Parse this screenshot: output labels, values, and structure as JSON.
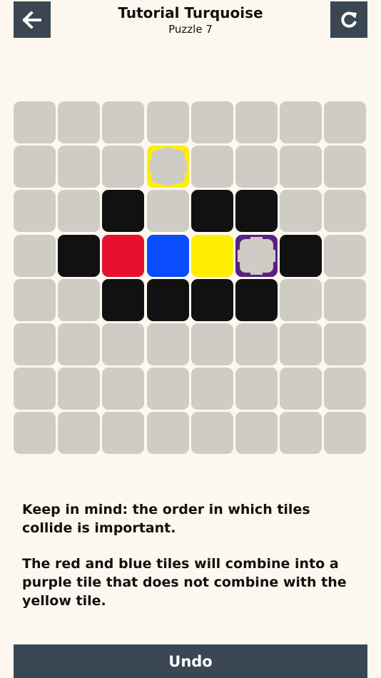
{
  "header": {
    "title": "Tutorial Turquoise",
    "subtitle": "Puzzle 7",
    "back_icon": "arrow-left-icon",
    "restart_icon": "restart-icon"
  },
  "colors": {
    "background": "#fdf8ef",
    "button": "#3a4753",
    "empty_cell": "#cfcbc5",
    "black": "#111111",
    "red": "#e8112d",
    "blue": "#0a4dff",
    "yellow": "#ffee00",
    "purple": "#5a1f82"
  },
  "board": {
    "rows": 8,
    "cols": 8,
    "grid": [
      [
        "empty",
        "empty",
        "empty",
        "empty",
        "empty",
        "empty",
        "empty",
        "empty"
      ],
      [
        "empty",
        "empty",
        "empty",
        "target-yellow",
        "empty",
        "empty",
        "empty",
        "empty"
      ],
      [
        "empty",
        "empty",
        "black",
        "empty",
        "black",
        "black",
        "empty",
        "empty"
      ],
      [
        "empty",
        "black",
        "red",
        "blue",
        "yellow",
        "target-purple",
        "black",
        "empty"
      ],
      [
        "empty",
        "empty",
        "black",
        "black",
        "black",
        "black",
        "empty",
        "empty"
      ],
      [
        "empty",
        "empty",
        "empty",
        "empty",
        "empty",
        "empty",
        "empty",
        "empty"
      ],
      [
        "empty",
        "empty",
        "empty",
        "empty",
        "empty",
        "empty",
        "empty",
        "empty"
      ],
      [
        "empty",
        "empty",
        "empty",
        "empty",
        "empty",
        "empty",
        "empty",
        "empty"
      ]
    ]
  },
  "hint": {
    "paragraph1": "Keep in mind: the order in which tiles collide is important.",
    "paragraph2": "The red and blue tiles will combine into a purple tile that does not combine with the yellow tile."
  },
  "undo_label": "Undo"
}
